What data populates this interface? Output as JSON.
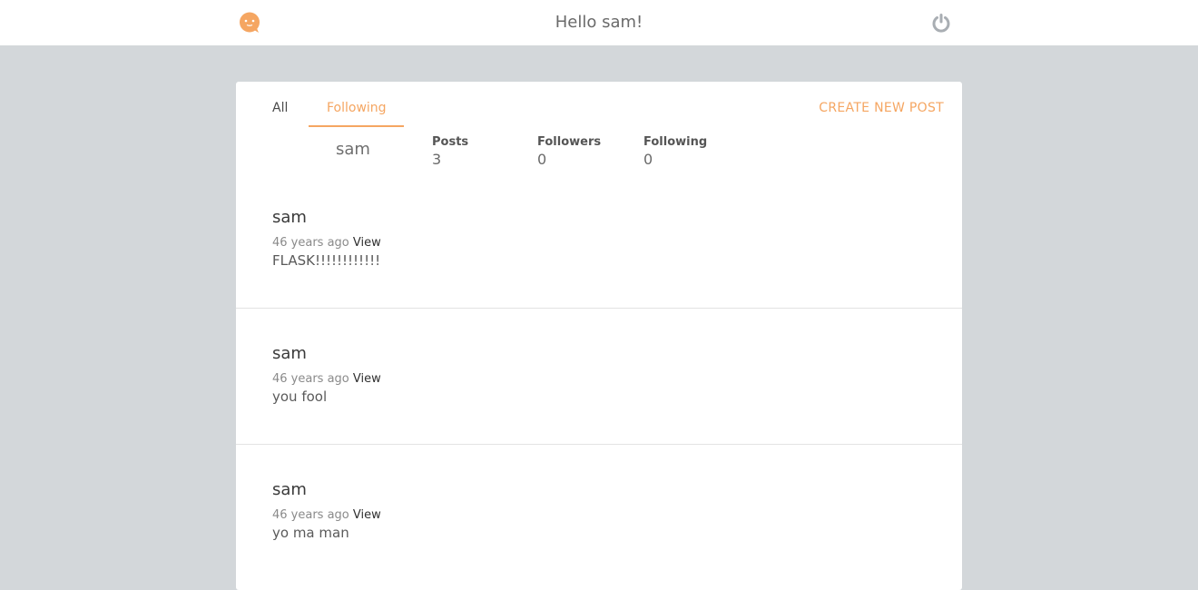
{
  "header": {
    "greeting": "Hello sam!",
    "logo_icon": "smiley-chat-icon",
    "power_icon": "power-icon"
  },
  "tabs": [
    {
      "label": "All",
      "active": false
    },
    {
      "label": "Following",
      "active": true
    }
  ],
  "actions": {
    "create_post": "CREATE NEW POST"
  },
  "profile": {
    "name": "sam",
    "stats": [
      {
        "label": "Posts",
        "value": "3"
      },
      {
        "label": "Followers",
        "value": "0"
      },
      {
        "label": "Following",
        "value": "0"
      }
    ]
  },
  "posts": [
    {
      "author": "sam",
      "time": "46 years ago",
      "view": "View",
      "body": "FLASK!!!!!!!!!!!!"
    },
    {
      "author": "sam",
      "time": "46 years ago",
      "view": "View",
      "body": "you fool"
    },
    {
      "author": "sam",
      "time": "46 years ago",
      "view": "View",
      "body": "yo ma man"
    }
  ],
  "colors": {
    "accent": "#f5a662",
    "background": "#d3d7da",
    "card": "#ffffff",
    "icon_gray": "#a9aeb3"
  }
}
